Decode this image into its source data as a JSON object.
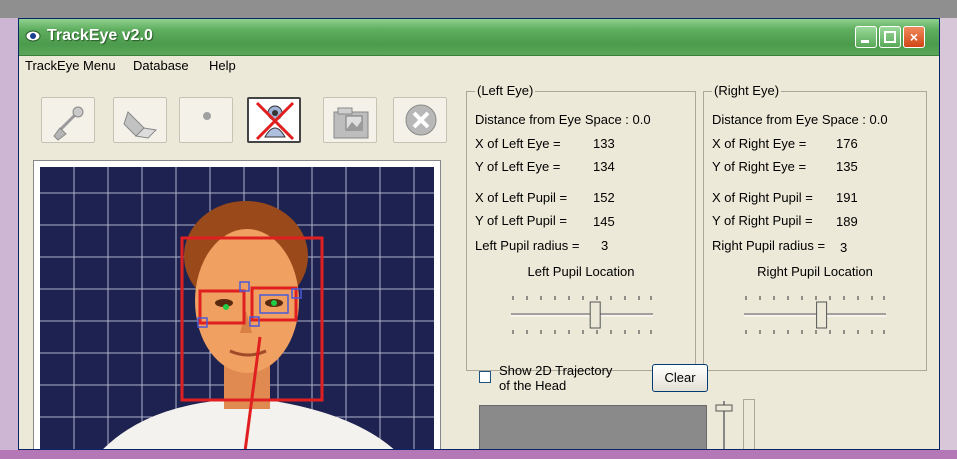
{
  "window": {
    "title": "TrackEye v2.0",
    "close_glyph": "×"
  },
  "menu": [
    "TrackEye Menu",
    "Database",
    "Help"
  ],
  "toolbar": [
    "brush-icon",
    "eraser-icon",
    "dot-icon",
    "no-person-icon",
    "folder-image-icon",
    "cancel-icon"
  ],
  "left_eye": {
    "legend": "(Left Eye)",
    "distance_label": "Distance from Eye Space : 0.0",
    "x_eye_label": "X of Left Eye =",
    "x_eye": "133",
    "y_eye_label": "Y of Left Eye =",
    "y_eye": "134",
    "x_pupil_label": "X of Left Pupil =",
    "x_pupil": "152",
    "y_pupil_label": "Y of Left Pupil =",
    "y_pupil": "145",
    "radius_label": "Left Pupil radius =",
    "radius": "3",
    "location_label": "Left Pupil Location",
    "slider_value": 0.6
  },
  "right_eye": {
    "legend": "(Right Eye)",
    "distance_label": "Distance from Eye Space : 0.0",
    "x_eye_label": "X of Right Eye =",
    "x_eye": "176",
    "y_eye_label": "Y of Right Eye =",
    "y_eye": "135",
    "x_pupil_label": "X of Right Pupil =",
    "x_pupil": "191",
    "y_pupil_label": "Y of Right Pupil =",
    "y_pupil": "189",
    "radius_label": "Right Pupil radius =",
    "radius": "3",
    "location_label": "Right Pupil Location",
    "slider_value": 0.55
  },
  "trajectory": {
    "checkbox_line1": "Show 2D Trajectory",
    "checkbox_line2": "of the Head",
    "checked": false,
    "clear_label": "Clear"
  },
  "colors": {
    "title_bar": "#5aa65a",
    "video_bg": "#1e2250",
    "face_box": "#e02020",
    "pupil_marker": "#22cc44"
  }
}
